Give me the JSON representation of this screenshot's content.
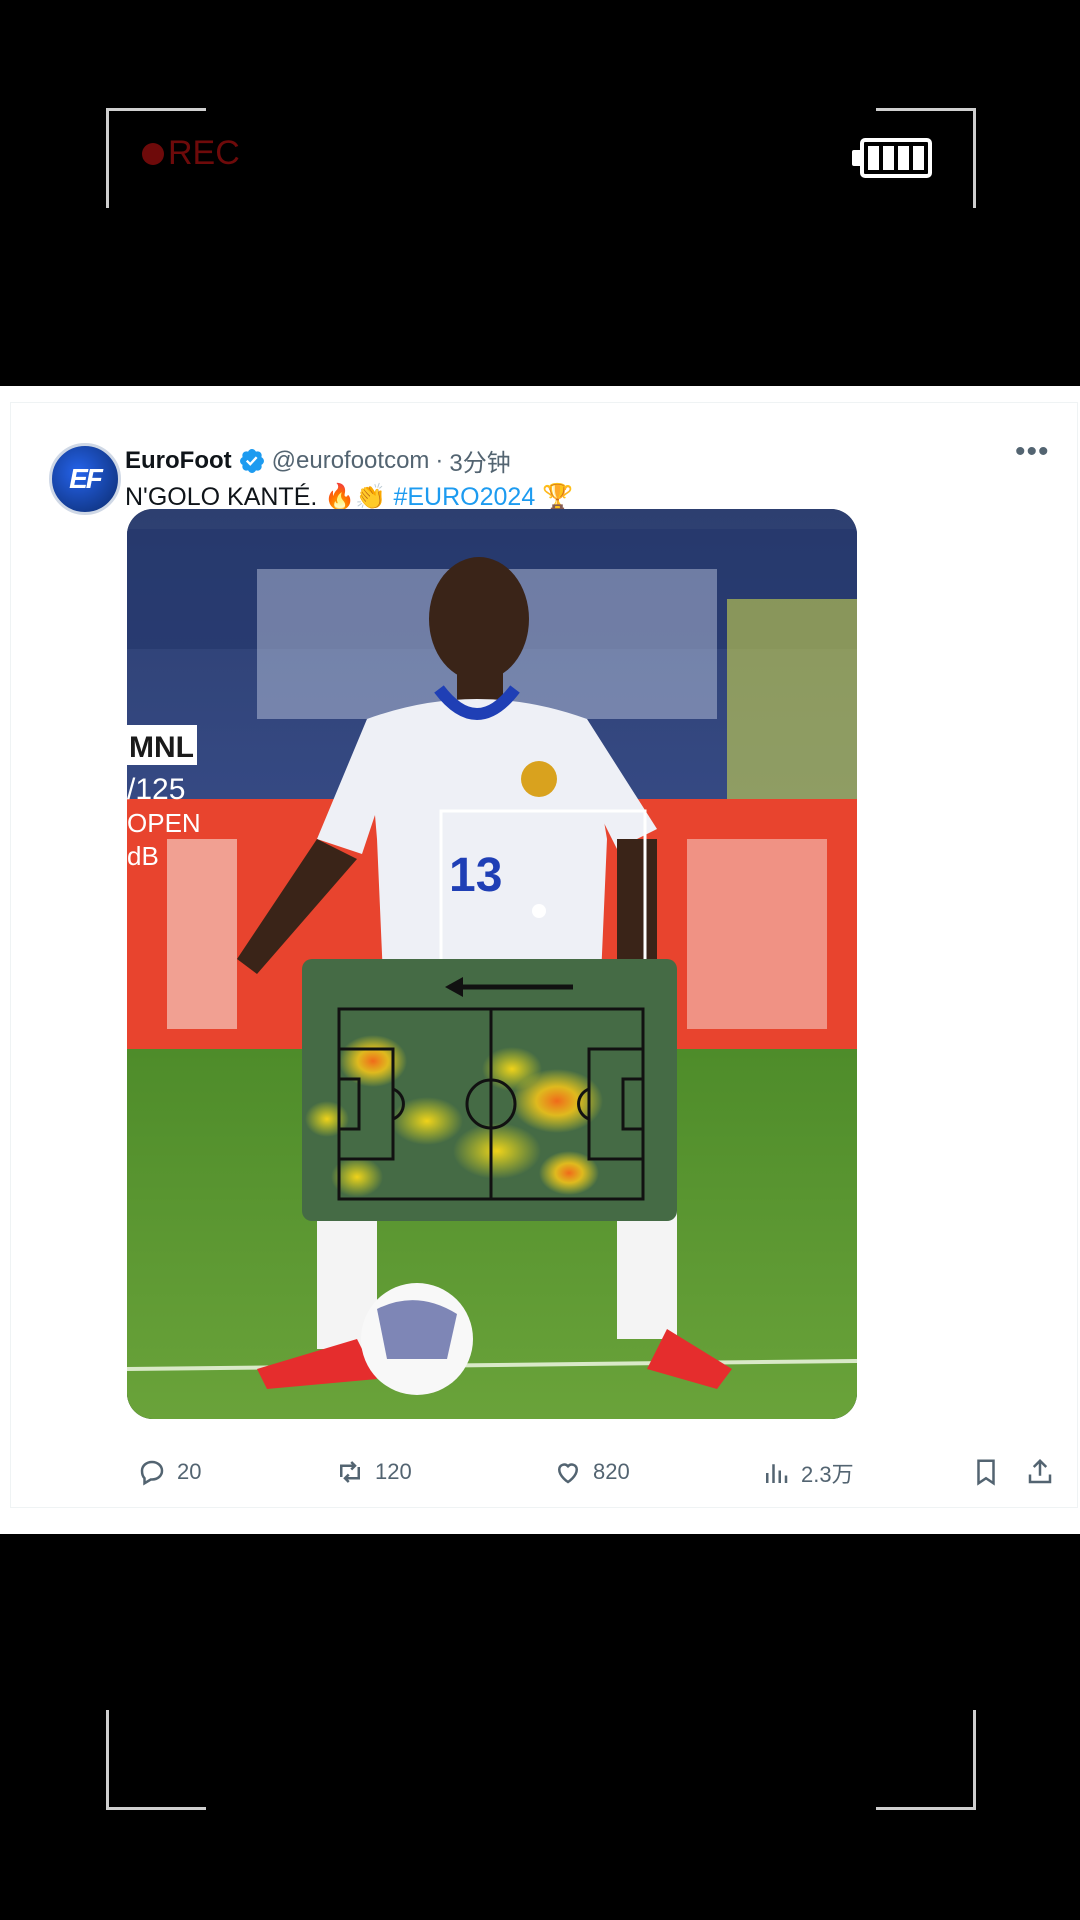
{
  "overlay": {
    "rec_label": "REC",
    "battery_icon": "battery-full-icon"
  },
  "tweet": {
    "author_name": "EuroFoot",
    "verified": true,
    "handle": "@eurofootcom",
    "separator": "·",
    "time": "3分钟",
    "text_main": "N'GOLO KANTÉ. 🔥👏",
    "text_hashtag": "#EURO2024",
    "text_emoji_tail": "🏆",
    "more_icon": "more-horizontal-icon",
    "image_overlay": {
      "badge": "MNL",
      "line1": "/125",
      "line2": "OPEN",
      "line3": "dB",
      "shirt_number": "13"
    }
  },
  "actions": {
    "reply_count": "20",
    "retweet_count": "120",
    "like_count": "820",
    "views_count": "2.3万"
  },
  "colors": {
    "accent": "#1d9bf0",
    "text_secondary": "#536471",
    "rec_red": "#6e0a0a"
  }
}
